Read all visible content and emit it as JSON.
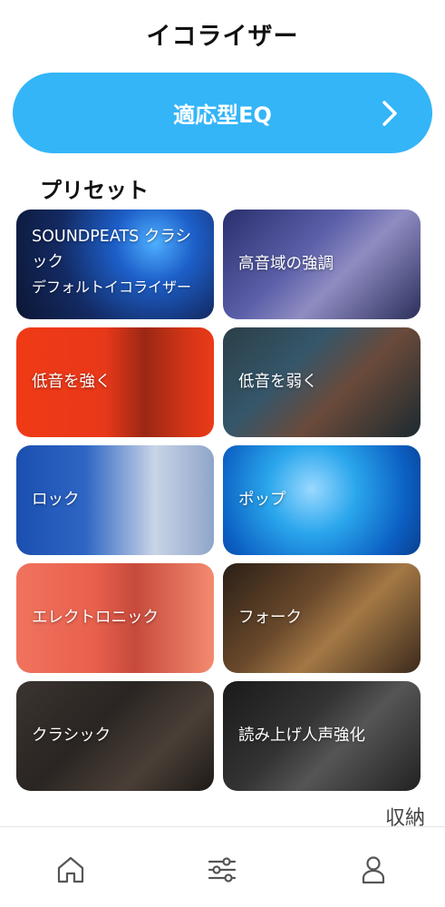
{
  "header": {
    "title": "イコライザー"
  },
  "adaptive_eq": {
    "label": "適応型EQ",
    "icon": "chevron-right-icon"
  },
  "presets": {
    "heading": "プリセット",
    "items": [
      {
        "label": "SOUNDPEATS クラシック",
        "sublabel": "デフォルトイコライザー"
      },
      {
        "label": "高音域の強調"
      },
      {
        "label": "低音を強く"
      },
      {
        "label": "低音を弱く"
      },
      {
        "label": "ロック"
      },
      {
        "label": "ポップ"
      },
      {
        "label": "エレクトロニック"
      },
      {
        "label": "フォーク"
      },
      {
        "label": "クラシック"
      },
      {
        "label": "読み上げ人声強化"
      }
    ]
  },
  "fold_label": "収納",
  "bottom_nav": {
    "items": [
      "home-icon",
      "sliders-icon",
      "person-icon"
    ]
  },
  "colors": {
    "accent": "#34b5f7"
  }
}
